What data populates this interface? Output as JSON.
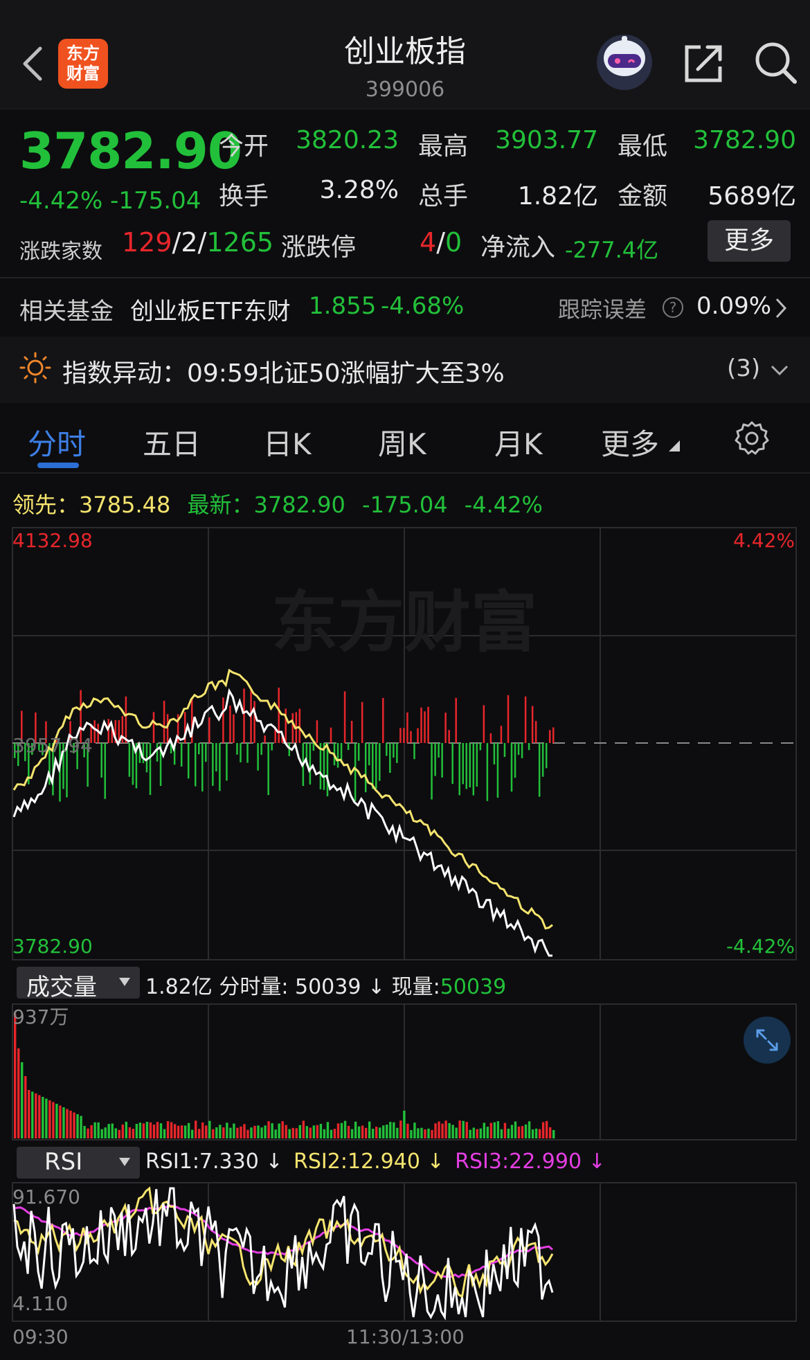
{
  "header": {
    "logo_line1": "东方",
    "logo_line2": "财富",
    "title": "创业板指",
    "code": "399006"
  },
  "quote": {
    "price": "3782.90",
    "change_pct": "-4.42%",
    "change_abs": "-175.04",
    "open_label": "今开",
    "open": "3820.23",
    "high_label": "最高",
    "high": "3903.77",
    "low_label": "最低",
    "low": "3782.90",
    "turnover_label": "换手",
    "turnover": "3.28%",
    "volume_label": "总手",
    "volume": "1.82亿",
    "amount_label": "金额",
    "amount": "5689亿",
    "breadth_label": "涨跌家数",
    "up": "129",
    "flat": "2",
    "down": "1265",
    "limit_label": "涨跌停",
    "limit_up": "4",
    "limit_down": "0",
    "netflow_label": "净流入",
    "netflow": "-277.4亿",
    "more_label": "更多",
    "sep": "/"
  },
  "fund": {
    "label": "相关基金",
    "name": "创业板ETF东财",
    "price": "1.855",
    "pct": "-4.68%",
    "tracking_label": "跟踪误差",
    "tracking_value": "0.09%"
  },
  "alert": {
    "text": "指数异动：09:59北证50涨幅扩大至3%",
    "count": "(3)"
  },
  "tabs": [
    "分时",
    "五日",
    "日K",
    "周K",
    "月K",
    "更多"
  ],
  "leader": {
    "leader_label": "领先：",
    "leader_value": "3785.48",
    "latest_label": "最新：",
    "latest_value": "3782.90",
    "chg": "-175.04",
    "pct": "-4.42%"
  },
  "intraday": {
    "top_price": "4132.98",
    "mid_price": "3957.94",
    "bottom_price": "3782.90",
    "top_pct": "4.42%",
    "bottom_pct": "-4.42%",
    "watermark": "东方财富"
  },
  "volume": {
    "selector": "成交量",
    "total": "1.82亿",
    "tick_label": "分时量:",
    "tick_value": "50039",
    "arrow": "↓",
    "now_label": "现量:",
    "now_value": "50039",
    "max_label": "937万"
  },
  "rsi": {
    "selector": "RSI",
    "rsi1": "RSI1:7.330 ↓",
    "rsi2": "RSI2:12.940 ↓",
    "rsi3": "RSI3:22.990 ↓",
    "top": "91.670",
    "bottom": "4.110"
  },
  "time_axis": {
    "start": "09:30",
    "mid": "11:30/13:00"
  },
  "colors": {
    "up": "#e8262b",
    "down": "#22c03a",
    "price_line": "#ffffff",
    "avg_line": "#f5e46e",
    "rsi3": "#e43ee2",
    "accent": "#2b6fd6"
  }
}
